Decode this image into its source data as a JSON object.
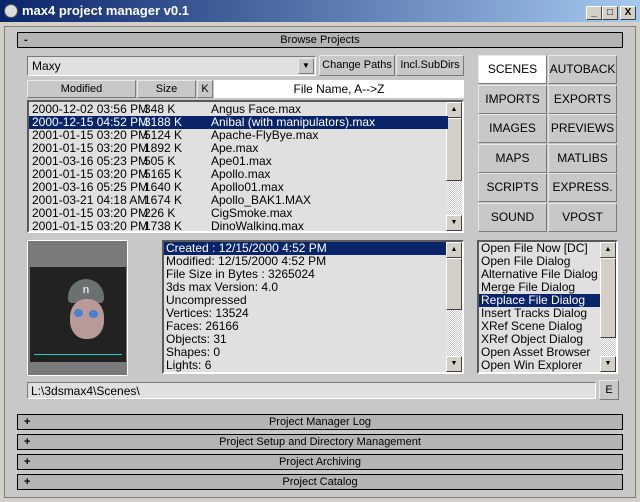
{
  "window": {
    "title": "max4 project manager v0.1",
    "minimize": "_",
    "maximize": "□",
    "close": "X"
  },
  "browse": {
    "title": "Browse Projects",
    "sign": "-",
    "project": "Maxy",
    "change_paths": "Change Paths",
    "incl_subdirs": "Incl.SubDirs",
    "headers": {
      "modified": "Modified",
      "size": "Size",
      "k": "K",
      "name": "File Name, A-->Z"
    },
    "files": [
      {
        "modified": "2000-12-02 03:56 PM",
        "size": "348 K",
        "name": "Angus Face.max"
      },
      {
        "modified": "2000-12-15 04:52 PM",
        "size": "3188 K",
        "name": "Anibal (with manipulators).max",
        "selected": true
      },
      {
        "modified": "2001-01-15 03:20 PM",
        "size": "5124 K",
        "name": "Apache-FlyBye.max"
      },
      {
        "modified": "2001-01-15 03:20 PM",
        "size": "1892 K",
        "name": "Ape.max"
      },
      {
        "modified": "2001-03-16 05:23 PM",
        "size": "505 K",
        "name": "Ape01.max"
      },
      {
        "modified": "2001-01-15 03:20 PM",
        "size": "5165 K",
        "name": "Apollo.max"
      },
      {
        "modified": "2001-03-16 05:25 PM",
        "size": "1640 K",
        "name": "Apollo01.max"
      },
      {
        "modified": "2001-03-21 04:18 AM",
        "size": "1674 K",
        "name": "Apollo_BAK1.MAX"
      },
      {
        "modified": "2001-01-15 03:20 PM",
        "size": "226 K",
        "name": "CigSmoke.max"
      },
      {
        "modified": "2001-01-15 03:20 PM",
        "size": "1738 K",
        "name": "DinoWalking.max"
      }
    ],
    "categories": [
      "SCENES",
      "AUTOBACK",
      "IMPORTS",
      "EXPORTS",
      "IMAGES",
      "PREVIEWS",
      "MAPS",
      "MATLIBS",
      "SCRIPTS",
      "EXPRESS.",
      "SOUND",
      "VPOST"
    ],
    "active_category": "SCENES",
    "info": [
      "Created : 12/15/2000 4:52 PM",
      "Modified: 12/15/2000 4:52 PM",
      "File Size in Bytes : 3265024",
      "3ds max Version: 4.0",
      "Uncompressed",
      "Vertices: 13524",
      "Faces: 26166",
      "Objects: 31",
      "Shapes: 0",
      "Lights: 6"
    ],
    "actions": [
      "Open File Now [DC]",
      "Open File Dialog",
      "Alternative File Dialog",
      "Merge File Dialog",
      "Replace File Dialog",
      "Insert Tracks Dialog",
      "XRef Scene Dialog",
      "XRef Object Dialog",
      "Open Asset Browser",
      "Open Win Explorer"
    ],
    "selected_action": "Replace File Dialog",
    "path": "L:\\3dsmax4\\Scenes\\",
    "explore": "E",
    "preview_logo": "n"
  },
  "rollouts": [
    {
      "sign": "+",
      "title": "Project Manager Log"
    },
    {
      "sign": "+",
      "title": "Project Setup and Directory Management"
    },
    {
      "sign": "+",
      "title": "Project Archiving"
    },
    {
      "sign": "+",
      "title": "Project Catalog"
    }
  ]
}
